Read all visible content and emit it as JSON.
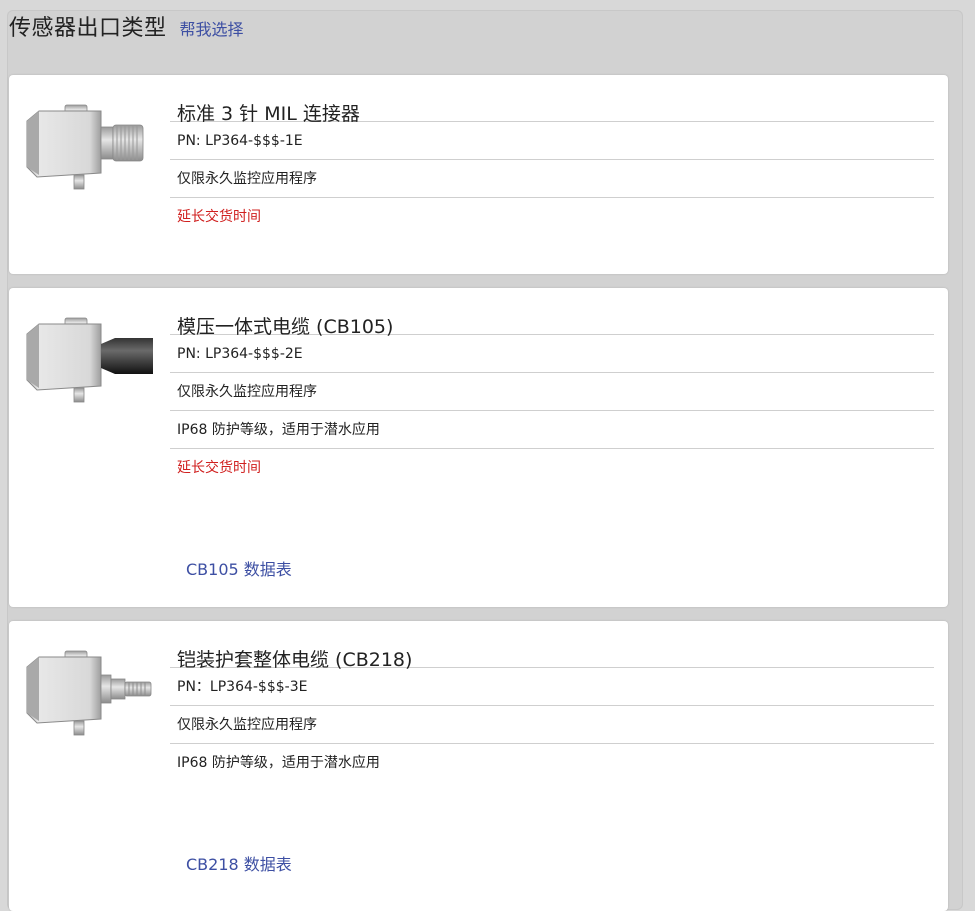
{
  "header": {
    "title": "传感器出口类型",
    "help_link": "帮我选择"
  },
  "products": [
    {
      "title": "标准 3 针 MIL 连接器",
      "pn": "PN: LP364-$$$-1E",
      "rows": [
        "仅限永久监控应用程序"
      ],
      "warning": "延长交货时间",
      "datasheet": null,
      "image_icon": "sensor-mil-connector-image"
    },
    {
      "title": "模压一体式电缆 (CB105)",
      "pn": "PN: LP364-$$$-2E",
      "rows": [
        "仅限永久监控应用程序",
        "IP68 防护等级，适用于潜水应用"
      ],
      "warning": "延长交货时间",
      "datasheet": "CB105 数据表",
      "image_icon": "sensor-molded-cable-image"
    },
    {
      "title": "铠装护套整体电缆 (CB218)",
      "pn": "PN：LP364-$$$-3E",
      "rows": [
        "仅限永久监控应用程序",
        "IP68 防护等级，适用于潜水应用"
      ],
      "warning": null,
      "datasheet": "CB218 数据表",
      "image_icon": "sensor-armored-cable-image"
    }
  ],
  "colors": {
    "link": "#3d4fa3",
    "warning": "#d0201f",
    "panel_bg": "#d2d2d2",
    "card_bg": "#ffffff"
  }
}
